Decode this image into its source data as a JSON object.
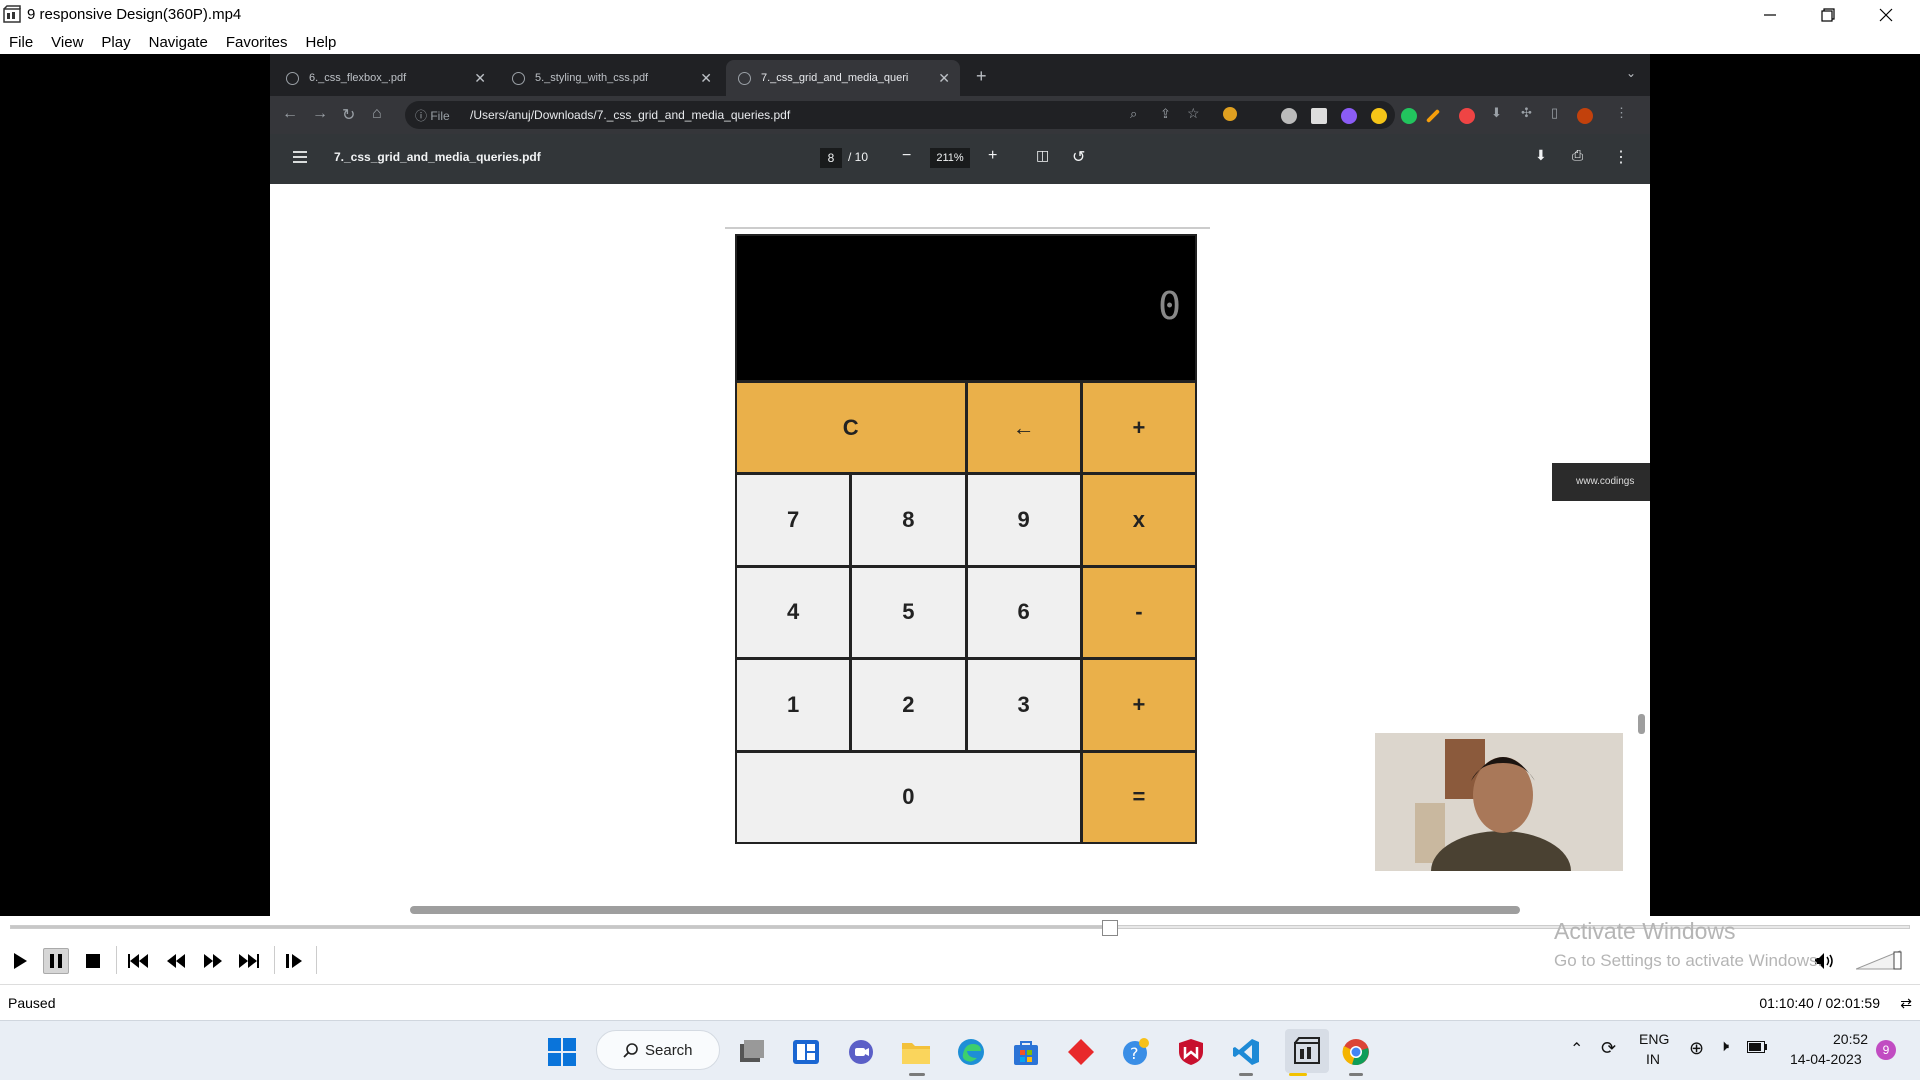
{
  "window": {
    "title": "9 responsive Design(360P).mp4"
  },
  "menu": [
    "File",
    "View",
    "Play",
    "Navigate",
    "Favorites",
    "Help"
  ],
  "browser": {
    "tabs": [
      {
        "label": "6._css_flexbox_.pdf"
      },
      {
        "label": "5._styling_with_css.pdf"
      },
      {
        "label": "7._css_grid_and_media_queri"
      }
    ],
    "omnibox": {
      "scheme": "File",
      "url": "/Users/anuj/Downloads/7._css_grid_and_media_queries.pdf"
    },
    "pdf": {
      "title": "7._css_grid_and_media_queries.pdf",
      "page_current": "8",
      "page_total": "/ 10",
      "zoom": "211%"
    },
    "side_float": "www.codings"
  },
  "calculator": {
    "display": "0",
    "keys": [
      {
        "label": "C",
        "op": true,
        "span": 2
      },
      {
        "label": "←",
        "op": false
      },
      {
        "label": "+",
        "op": true
      },
      {
        "label": "7",
        "op": false
      },
      {
        "label": "8",
        "op": false
      },
      {
        "label": "9",
        "op": false
      },
      {
        "label": "x",
        "op": true
      },
      {
        "label": "4",
        "op": false
      },
      {
        "label": "5",
        "op": false
      },
      {
        "label": "6",
        "op": false
      },
      {
        "label": "-",
        "op": true
      },
      {
        "label": "1",
        "op": false
      },
      {
        "label": "2",
        "op": false
      },
      {
        "label": "3",
        "op": false
      },
      {
        "label": "+",
        "op": true
      },
      {
        "label": "0",
        "op": false,
        "span": 3
      },
      {
        "label": "=",
        "op": true
      }
    ],
    "colors": {
      "operator": "#eab04a",
      "number": "#f0f0f0",
      "display": "#000000"
    }
  },
  "player": {
    "status": "Paused",
    "time": "01:10:40 / 02:01:59",
    "progress": 0.578,
    "watermark_title": "Activate Windows",
    "watermark_sub": "Go to Settings to activate Windows."
  },
  "taskbar": {
    "search_label": "Search",
    "lang_top": "ENG",
    "lang_bottom": "IN",
    "clock_time": "20:52",
    "clock_date": "14-04-2023",
    "notification_count": "9"
  }
}
